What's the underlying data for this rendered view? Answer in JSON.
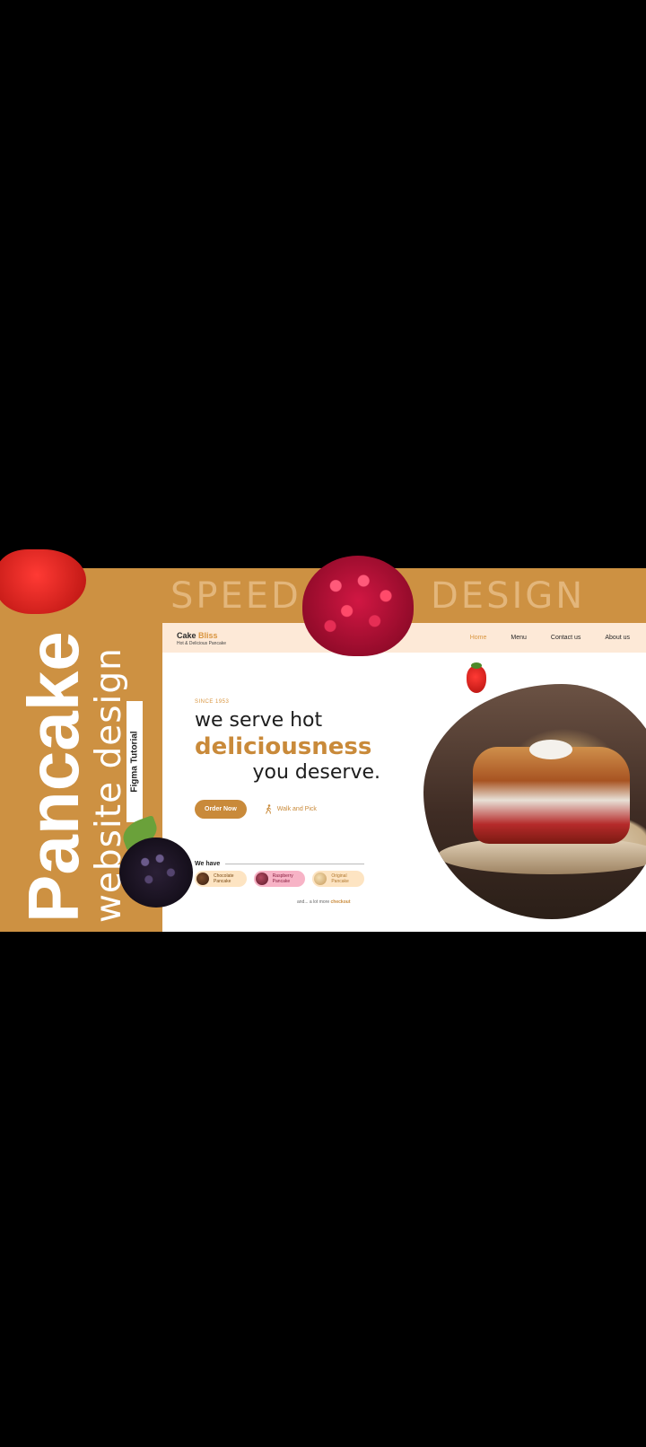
{
  "banner": {
    "word1": "SPEED",
    "word2": "DESIGN"
  },
  "side": {
    "title": "Pancake",
    "subtitle": "website design",
    "tag": "Figma Tutorial"
  },
  "site": {
    "brand": {
      "name_part1": "Cake ",
      "name_part2": "Bliss",
      "tagline": "Hot & Delicious Pancake"
    },
    "nav": [
      {
        "label": "Home",
        "active": true
      },
      {
        "label": "Menu",
        "active": false
      },
      {
        "label": "Contact us",
        "active": false
      },
      {
        "label": "About us",
        "active": false
      }
    ],
    "hero": {
      "since": "SINCE 1953",
      "line1": "we serve hot",
      "line2": "deliciousness",
      "line3": "you deserve."
    },
    "cta": {
      "order": "Order Now",
      "walk": "Walk and Pick"
    },
    "we_have": {
      "label": "We have",
      "items": [
        {
          "line1": "Chocolate",
          "line2": "Pancake"
        },
        {
          "line1": "Raspberry",
          "line2": "Pancake"
        },
        {
          "line1": "Original",
          "line2": "Pancake"
        }
      ],
      "more_prefix": "and... a lot more ",
      "more_link": "checkout"
    }
  },
  "colors": {
    "brand": "#cd9142",
    "accent": "#c98a3a",
    "nav_bg": "#fde9d7"
  }
}
